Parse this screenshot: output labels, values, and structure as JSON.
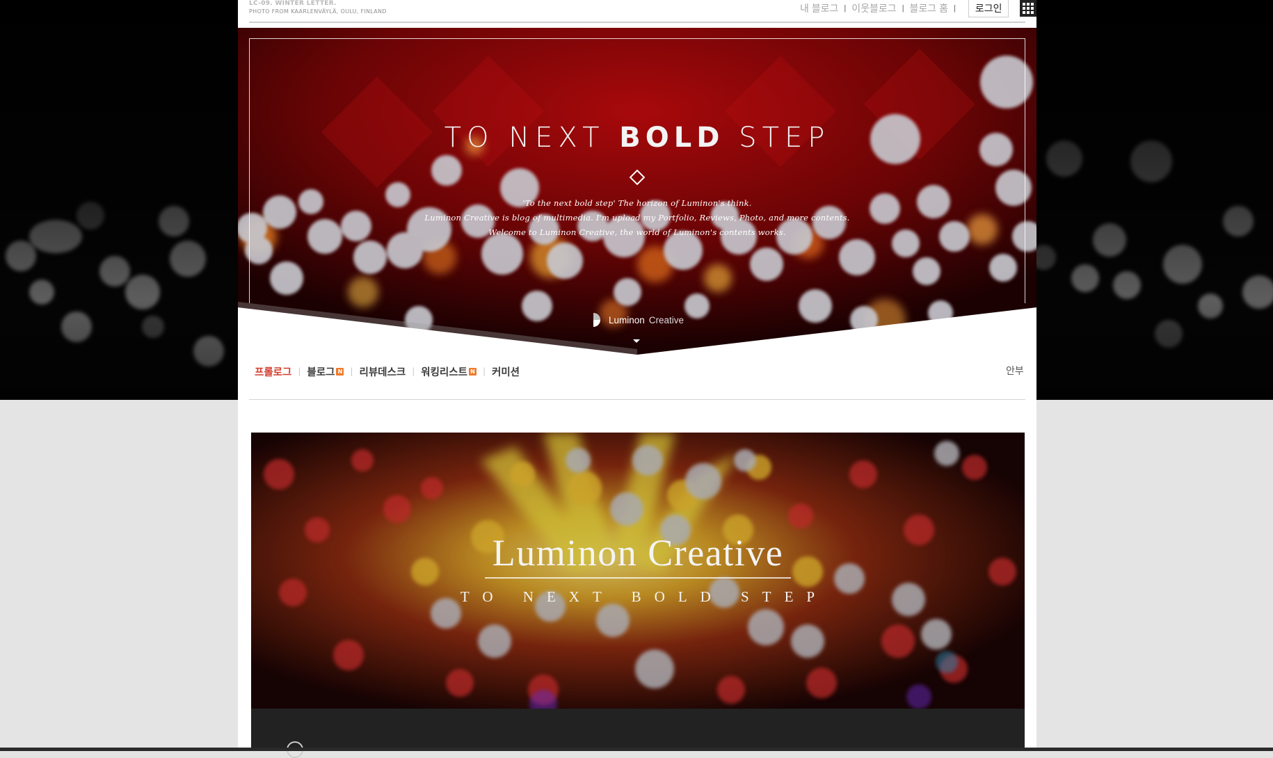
{
  "brand_mini": {
    "code": "LC-09. WINTER LETTER.",
    "credit": "PHOTO FROM KAARLENVÄYLÄ, OULU, FINLAND"
  },
  "topnav": {
    "links": [
      "내 블로그",
      "이웃블로그",
      "블로그 홈"
    ],
    "login": "로그인",
    "apps_icon": "grid-icon"
  },
  "hero": {
    "title_light_1": "TO NEXT ",
    "title_bold": "BOLD",
    "title_light_2": " STEP",
    "tagline": [
      "'To the next bold step' The horizon of Luminon's think.",
      "Luminon Creative is blog of multimedia. I'm upload my Portfolio, Reviews, Photo, and more contents.",
      "Welcome to Luminon Creative, the world of Luminon's contents works."
    ],
    "brand_bold": "Luminon",
    "brand_light": "Creative"
  },
  "mainnav": {
    "items": [
      {
        "label": "프롤로그",
        "active": true,
        "new": false
      },
      {
        "label": "블로그",
        "active": false,
        "new": true
      },
      {
        "label": "리뷰데스크",
        "active": false,
        "new": false
      },
      {
        "label": "워킹리스트",
        "active": false,
        "new": true
      },
      {
        "label": "커미션",
        "active": false,
        "new": false
      }
    ],
    "new_badge": "N",
    "guide": "안부"
  },
  "banner": {
    "title": "Luminon Creative",
    "subtitle": "TO NEXT BOLD STEP"
  },
  "colors": {
    "active_nav": "#d23c2c",
    "new_badge": "#f07a2a",
    "hero_red": "#8a0a0c"
  }
}
